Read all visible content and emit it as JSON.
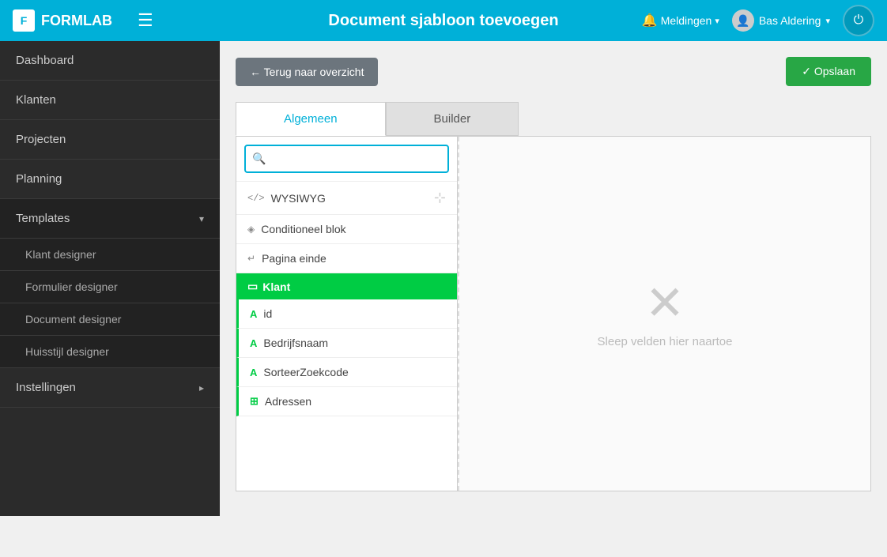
{
  "app": {
    "logo_text": "FORMLAB",
    "logo_letter": "F"
  },
  "topbar": {
    "title": "Document sjabloon toevoegen",
    "notifications_label": "Meldingen",
    "user_label": "Bas Aldering"
  },
  "sidebar": {
    "items": [
      {
        "id": "dashboard",
        "label": "Dashboard",
        "has_children": false
      },
      {
        "id": "klanten",
        "label": "Klanten",
        "has_children": false
      },
      {
        "id": "projecten",
        "label": "Projecten",
        "has_children": false
      },
      {
        "id": "planning",
        "label": "Planning",
        "has_children": false
      },
      {
        "id": "templates",
        "label": "Templates",
        "has_children": true,
        "expanded": true
      },
      {
        "id": "instellingen",
        "label": "Instellingen",
        "has_children": true,
        "expanded": false
      }
    ],
    "sub_items": [
      {
        "id": "klant-designer",
        "label": "Klant designer"
      },
      {
        "id": "formulier-designer",
        "label": "Formulier designer"
      },
      {
        "id": "document-designer",
        "label": "Document designer"
      },
      {
        "id": "huisstijl-designer",
        "label": "Huisstijl designer"
      }
    ]
  },
  "action_bar": {
    "back_label": "← Terug naar overzicht",
    "save_label": "✓ Opslaan"
  },
  "tabs": [
    {
      "id": "algemeen",
      "label": "Algemeen",
      "active": true
    },
    {
      "id": "builder",
      "label": "Builder",
      "active": false
    }
  ],
  "fields_panel": {
    "search_placeholder": "🔍",
    "items": [
      {
        "id": "wysiwyg",
        "icon": "</>",
        "label": "WYSIWYG",
        "type": "wysiwyg"
      },
      {
        "id": "conditioneel-blok",
        "icon": "◈",
        "label": "Conditioneel blok",
        "type": "conditional"
      },
      {
        "id": "pagina-einde",
        "icon": "↵",
        "label": "Pagina einde",
        "type": "page-end"
      }
    ],
    "klant_section": {
      "label": "Klant",
      "icon": "▭",
      "fields": [
        {
          "id": "id",
          "icon": "A",
          "label": "id"
        },
        {
          "id": "bedrijfsnaam",
          "icon": "A",
          "label": "Bedrijfsnaam"
        },
        {
          "id": "sorteerzoekcode",
          "icon": "A",
          "label": "SorteerZoekcode"
        },
        {
          "id": "adressen",
          "icon": "⊞",
          "label": "Adressen"
        }
      ]
    }
  },
  "drop_zone": {
    "icon": "✕",
    "text": "Sleep velden hier naartoe"
  }
}
